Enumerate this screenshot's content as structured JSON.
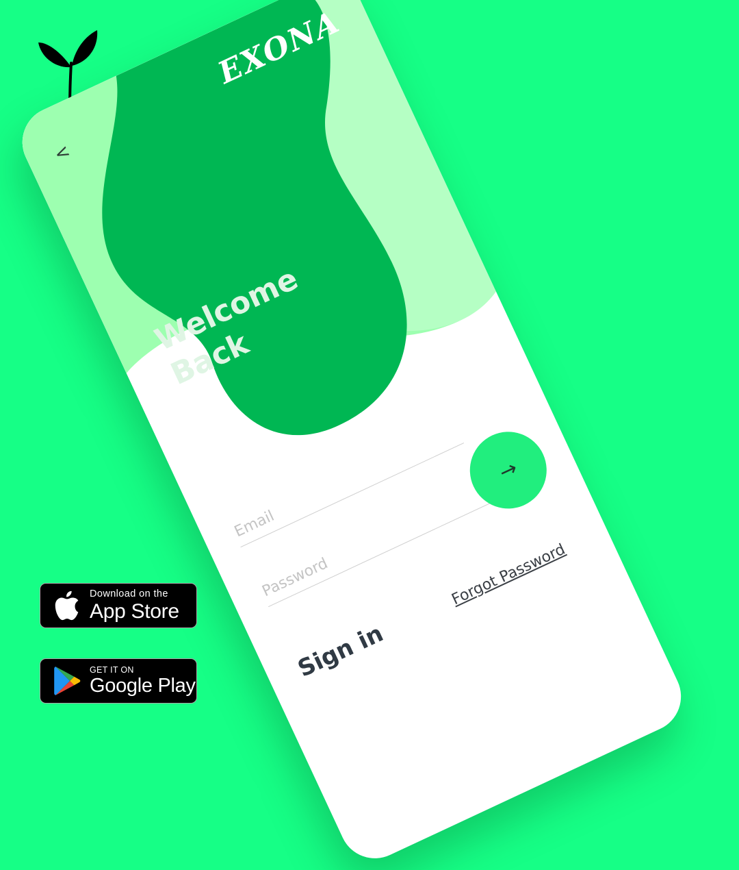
{
  "logo": {
    "icon": "sprout-icon"
  },
  "phone": {
    "brand": "EXONA",
    "back_icon": "<",
    "welcome_line1": "Welcome",
    "welcome_line2": "Back",
    "email_placeholder": "Email",
    "password_placeholder": "Password",
    "submit_icon": "→",
    "signin_label": "Sign in",
    "forgot_label": "Forgot Password"
  },
  "badges": {
    "apple": {
      "small": "Download on the",
      "big": "App Store",
      "icon": "apple-icon"
    },
    "google": {
      "small": "GET IT ON",
      "big": "Google Play",
      "icon": "google-play-icon"
    }
  },
  "colors": {
    "background": "#16ff86",
    "blob_dark": "#00b753",
    "blob_light": "#9dffb0",
    "button": "#21ee7e"
  }
}
